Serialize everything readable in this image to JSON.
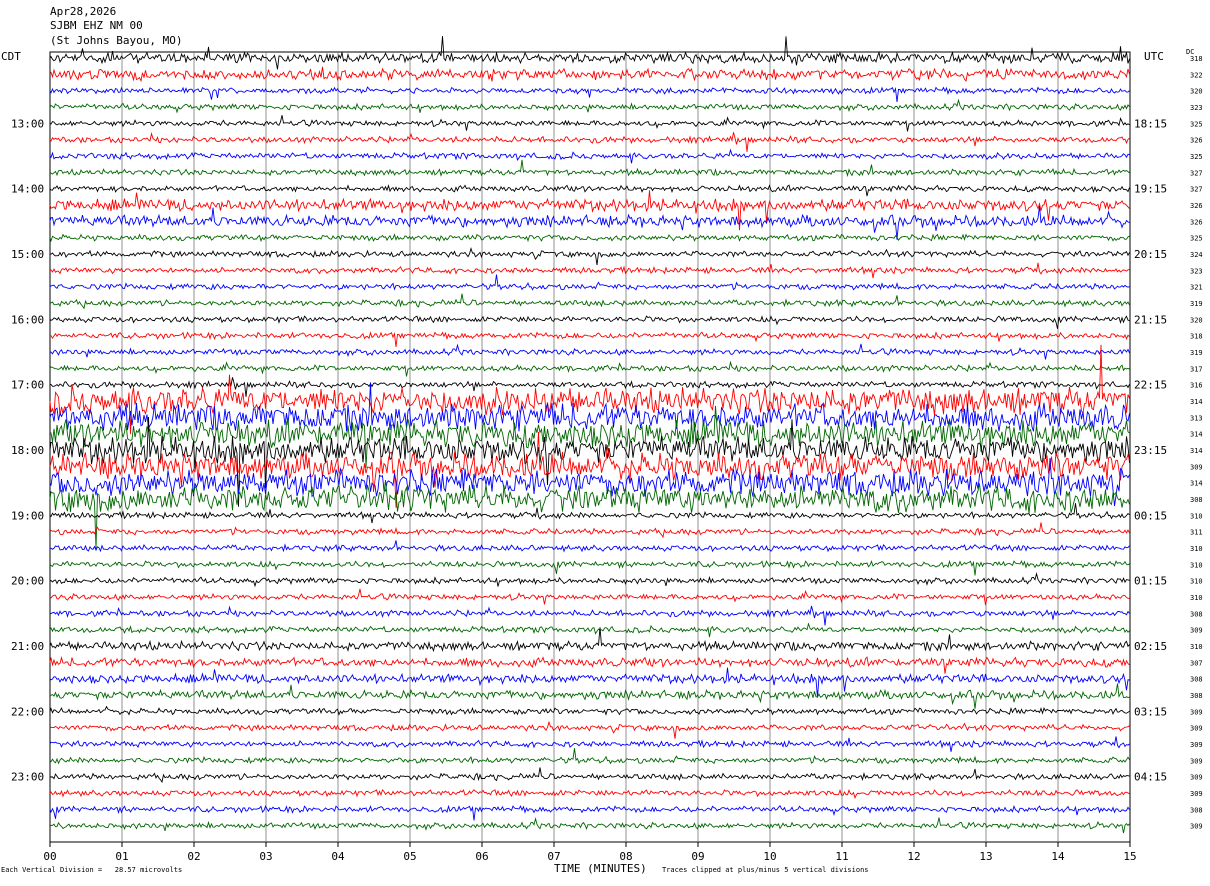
{
  "header": {
    "date": "Apr28,2026",
    "station": "SJBM EHZ NM 00",
    "location": "(St Johns Bayou, MO)"
  },
  "chart_data": {
    "type": "line",
    "title": "SJBM EHZ NM 00",
    "xlabel": "TIME (MINUTES)",
    "xlim": [
      0,
      15
    ],
    "x_ticks": [
      "00",
      "01",
      "02",
      "03",
      "04",
      "05",
      "06",
      "07",
      "08",
      "09",
      "10",
      "11",
      "12",
      "13",
      "14",
      "15"
    ],
    "left_axis_label": "CDT",
    "right_axis_label": "UTC",
    "dc_label": "DC",
    "left_hour_labels": [
      "13:00",
      "14:00",
      "15:00",
      "16:00",
      "17:00",
      "18:00",
      "19:00",
      "20:00",
      "21:00",
      "22:00",
      "23:00"
    ],
    "right_hour_labels": [
      "18:15",
      "19:15",
      "20:15",
      "21:15",
      "22:15",
      "23:15",
      "00:15",
      "01:15",
      "02:15",
      "03:15",
      "04:15"
    ],
    "dc_values": [
      318,
      322,
      320,
      323,
      325,
      326,
      325,
      327,
      327,
      326,
      326,
      325,
      324,
      323,
      321,
      319,
      320,
      318,
      319,
      317,
      316,
      314,
      313,
      314,
      314,
      309,
      314,
      308,
      310,
      311,
      310,
      310,
      310,
      310,
      308,
      309,
      310,
      307,
      308,
      308,
      309,
      309,
      309,
      309,
      309,
      309,
      308,
      309
    ],
    "trace_color_cycle": [
      "#000000",
      "#ff0000",
      "#0000ff",
      "#006600"
    ],
    "grid": true,
    "footer_left": "Each Vertical Division =   28.57 microvolts",
    "footer_right": "Traces clipped at plus/minus 5 vertical divisions"
  }
}
